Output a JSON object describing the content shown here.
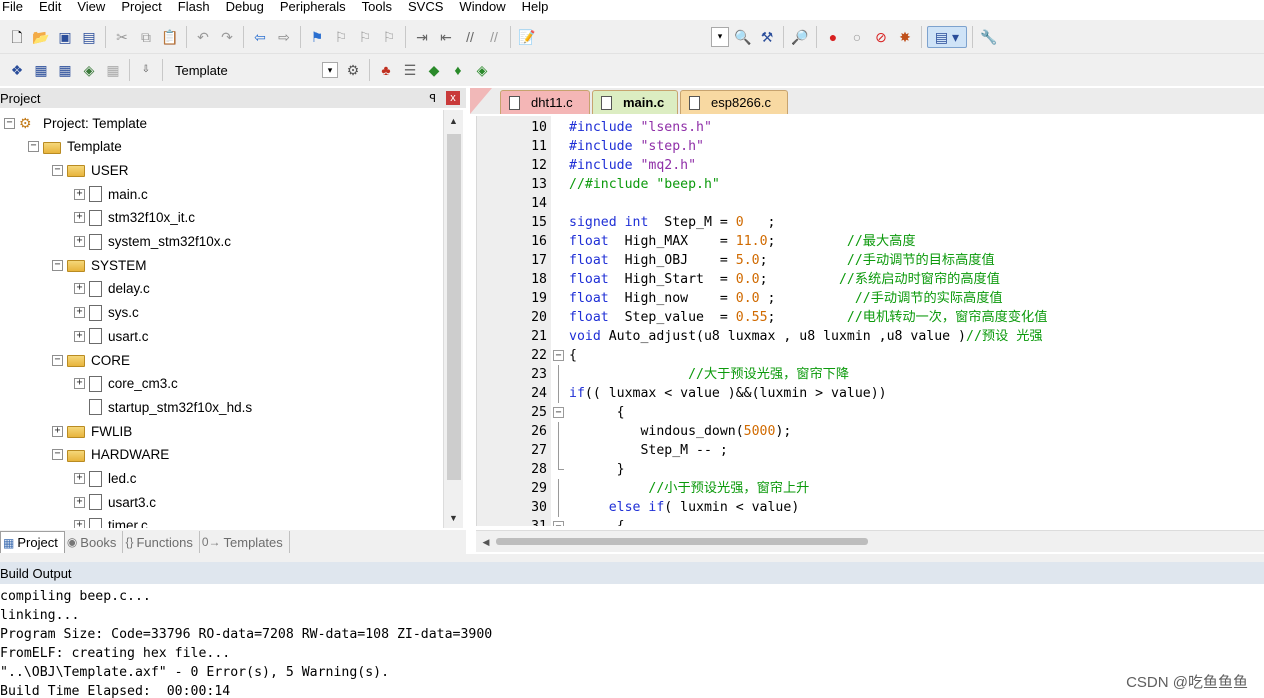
{
  "menu": [
    "File",
    "Edit",
    "View",
    "Project",
    "Flash",
    "Debug",
    "Peripherals",
    "Tools",
    "SVCS",
    "Window",
    "Help"
  ],
  "toolbar2": {
    "target": "Template"
  },
  "project_panel": {
    "title": "Project",
    "pin": "ꟼ",
    "close": "x",
    "tree": [
      {
        "label": "Project: Template",
        "level": 0,
        "kind": "project",
        "exp": "−"
      },
      {
        "label": "Template",
        "level": 1,
        "kind": "target",
        "exp": "−"
      },
      {
        "label": "USER",
        "level": 2,
        "kind": "folder",
        "exp": "−"
      },
      {
        "label": "main.c",
        "level": 3,
        "kind": "file",
        "exp": "+"
      },
      {
        "label": "stm32f10x_it.c",
        "level": 3,
        "kind": "file",
        "exp": "+"
      },
      {
        "label": "system_stm32f10x.c",
        "level": 3,
        "kind": "file",
        "exp": "+"
      },
      {
        "label": "SYSTEM",
        "level": 2,
        "kind": "folder",
        "exp": "−"
      },
      {
        "label": "delay.c",
        "level": 3,
        "kind": "file",
        "exp": "+"
      },
      {
        "label": "sys.c",
        "level": 3,
        "kind": "file",
        "exp": "+"
      },
      {
        "label": "usart.c",
        "level": 3,
        "kind": "file",
        "exp": "+"
      },
      {
        "label": "CORE",
        "level": 2,
        "kind": "folder",
        "exp": "−"
      },
      {
        "label": "core_cm3.c",
        "level": 3,
        "kind": "file",
        "exp": "+"
      },
      {
        "label": "startup_stm32f10x_hd.s",
        "level": 3,
        "kind": "file",
        "exp": ""
      },
      {
        "label": "FWLIB",
        "level": 2,
        "kind": "folder",
        "exp": "+"
      },
      {
        "label": "HARDWARE",
        "level": 2,
        "kind": "folder",
        "exp": "−"
      },
      {
        "label": "led.c",
        "level": 3,
        "kind": "file",
        "exp": "+"
      },
      {
        "label": "usart3.c",
        "level": 3,
        "kind": "file",
        "exp": "+"
      },
      {
        "label": "timer.c",
        "level": 3,
        "kind": "file",
        "exp": "+"
      }
    ],
    "tabs": [
      {
        "label": "Project",
        "icon": "▦",
        "active": true
      },
      {
        "label": "Books",
        "icon": "◉",
        "active": false
      },
      {
        "label": "Functions",
        "icon": "{}",
        "active": false
      },
      {
        "label": "Templates",
        "icon": "0→",
        "active": false
      }
    ]
  },
  "editor": {
    "tabs": [
      "dht11.c",
      "main.c",
      "esp8266.c"
    ],
    "active_tab": "main.c",
    "lines": [
      {
        "n": "10",
        "fold": "",
        "parts": [
          [
            "pp",
            "#include "
          ],
          [
            "str",
            "\"lsens.h\""
          ]
        ]
      },
      {
        "n": "11",
        "fold": "",
        "parts": [
          [
            "pp",
            "#include "
          ],
          [
            "str",
            "\"step.h\""
          ]
        ]
      },
      {
        "n": "12",
        "fold": "",
        "parts": [
          [
            "pp",
            "#include "
          ],
          [
            "str",
            "\"mq2.h\""
          ]
        ]
      },
      {
        "n": "13",
        "fold": "",
        "parts": [
          [
            "cmt",
            "//#include \"beep.h\""
          ]
        ]
      },
      {
        "n": "14",
        "fold": "",
        "parts": []
      },
      {
        "n": "15",
        "fold": "",
        "parts": [
          [
            "kw",
            "signed int"
          ],
          [
            "fn",
            "  Step_M = "
          ],
          [
            "num",
            "0"
          ],
          [
            "fn",
            "   ;"
          ]
        ]
      },
      {
        "n": "16",
        "fold": "",
        "parts": [
          [
            "kw",
            "float"
          ],
          [
            "fn",
            "  High_MAX    = "
          ],
          [
            "num",
            "11.0"
          ],
          [
            "fn",
            ";         "
          ],
          [
            "cmt",
            "//最大高度"
          ]
        ]
      },
      {
        "n": "17",
        "fold": "",
        "parts": [
          [
            "kw",
            "float"
          ],
          [
            "fn",
            "  High_OBJ    = "
          ],
          [
            "num",
            "5.0"
          ],
          [
            "fn",
            ";          "
          ],
          [
            "cmt",
            "//手动调节的目标高度值"
          ]
        ]
      },
      {
        "n": "18",
        "fold": "",
        "parts": [
          [
            "kw",
            "float"
          ],
          [
            "fn",
            "  High_Start  = "
          ],
          [
            "num",
            "0.0"
          ],
          [
            "fn",
            ";         "
          ],
          [
            "cmt",
            "//系统启动时窗帘的高度值"
          ]
        ]
      },
      {
        "n": "19",
        "fold": "",
        "parts": [
          [
            "kw",
            "float"
          ],
          [
            "fn",
            "  High_now    = "
          ],
          [
            "num",
            "0.0"
          ],
          [
            "fn",
            " ;          "
          ],
          [
            "cmt",
            "//手动调节的实际高度值"
          ]
        ]
      },
      {
        "n": "20",
        "fold": "",
        "parts": [
          [
            "kw",
            "float"
          ],
          [
            "fn",
            "  Step_value  = "
          ],
          [
            "num",
            "0.55"
          ],
          [
            "fn",
            ";         "
          ],
          [
            "cmt",
            "//电机转动一次，窗帘高度变化值"
          ]
        ]
      },
      {
        "n": "21",
        "fold": "",
        "parts": [
          [
            "kw",
            "void"
          ],
          [
            "fn",
            " Auto_adjust(u8 luxmax , u8 luxmin ,u8 value )"
          ],
          [
            "cmt",
            "//预设 光强"
          ]
        ]
      },
      {
        "n": "22",
        "fold": "open",
        "parts": [
          [
            "fn",
            "{"
          ]
        ]
      },
      {
        "n": "23",
        "fold": "line",
        "parts": [
          [
            "fn",
            "               "
          ],
          [
            "cmt",
            "//大于预设光强，窗帘下降"
          ]
        ]
      },
      {
        "n": "24",
        "fold": "line",
        "parts": [
          [
            "kw",
            "if"
          ],
          [
            "fn",
            "(( luxmax < value )&&(luxmin > value))"
          ]
        ]
      },
      {
        "n": "25",
        "fold": "open",
        "parts": [
          [
            "fn",
            "      {"
          ]
        ]
      },
      {
        "n": "26",
        "fold": "line",
        "parts": [
          [
            "fn",
            "         windous_down("
          ],
          [
            "num",
            "5000"
          ],
          [
            "fn",
            ");"
          ]
        ]
      },
      {
        "n": "27",
        "fold": "line",
        "parts": [
          [
            "fn",
            "         Step_M -- ;"
          ]
        ]
      },
      {
        "n": "28",
        "fold": "end",
        "parts": [
          [
            "fn",
            "      }"
          ]
        ]
      },
      {
        "n": "29",
        "fold": "line",
        "parts": [
          [
            "fn",
            "          "
          ],
          [
            "cmt",
            "//小于预设光强，窗帘上升"
          ]
        ]
      },
      {
        "n": "30",
        "fold": "line",
        "parts": [
          [
            "fn",
            "     "
          ],
          [
            "kw",
            "else if"
          ],
          [
            "fn",
            "( luxmin < value)"
          ]
        ]
      },
      {
        "n": "31",
        "fold": "open",
        "parts": [
          [
            "fn",
            "      {"
          ]
        ]
      }
    ]
  },
  "build_output": {
    "title": "Build Output",
    "lines": [
      "compiling beep.c...",
      "linking...",
      "Program Size: Code=33796 RO-data=7208 RW-data=108 ZI-data=3900",
      "FromELF: creating hex file...",
      "\"..\\OBJ\\Template.axf\" - 0 Error(s), 5 Warning(s).",
      "Build Time Elapsed:  00:00:14"
    ]
  },
  "watermark": "CSDN @吃鱼鱼鱼",
  "colors": {
    "keyword": "#1f2fd6",
    "string": "#8f2fa8",
    "comment": "#0c9a0c",
    "number": "#d06a00",
    "tab_dht11": "#f4b6b6",
    "tab_main": "#dcedc2",
    "tab_esp8266": "#f8d9a2"
  }
}
